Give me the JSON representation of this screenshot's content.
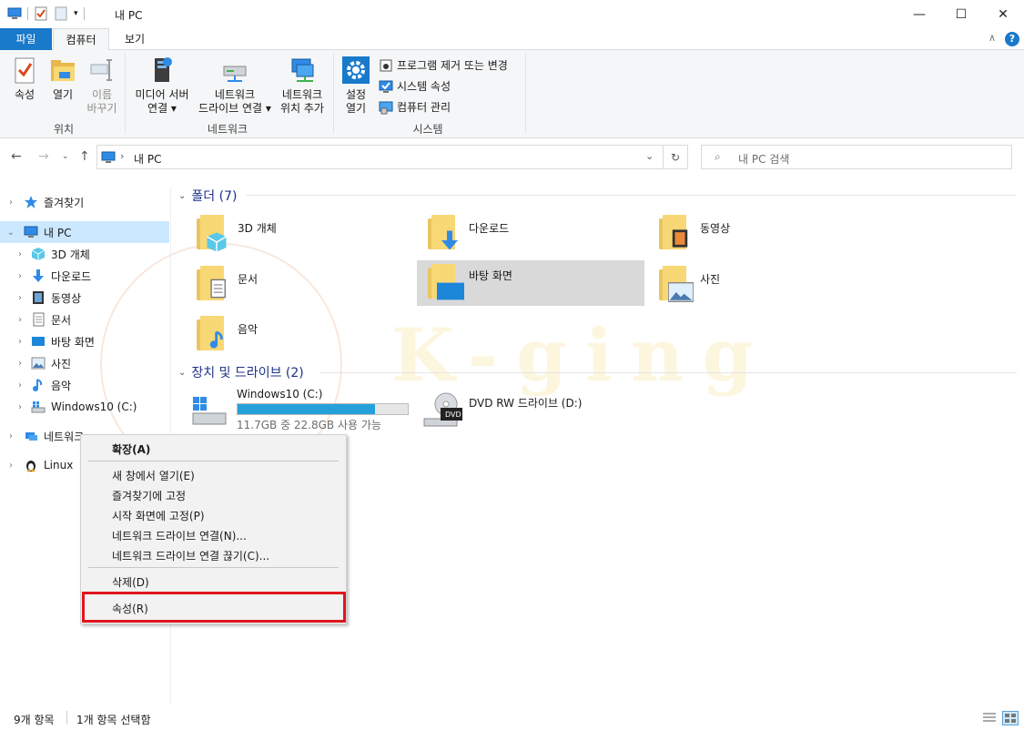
{
  "window": {
    "title": "내 PC",
    "minimize": "—",
    "maximize": "☐",
    "close": "✕"
  },
  "ribbon_tabs": [
    "파일",
    "컴퓨터",
    "보기"
  ],
  "ribbon": {
    "location": {
      "properties": "속성",
      "open": "열기",
      "rename_1": "이름",
      "rename_2": "바꾸기",
      "group": "위치"
    },
    "network": {
      "media_1": "미디어 서버",
      "media_2": "연결 ▾",
      "map_1": "네트워크",
      "map_2": "드라이브 연결 ▾",
      "add_1": "네트워크",
      "add_2": "위치 추가",
      "group": "네트워크"
    },
    "system": {
      "settings_1": "설정",
      "settings_2": "열기",
      "uninstall": "프로그램 제거 또는 변경",
      "sys_props": "시스템 속성",
      "manage": "컴퓨터 관리",
      "group": "시스템"
    }
  },
  "address": {
    "path": "내 PC",
    "search_placeholder": "내 PC 검색"
  },
  "nav": [
    {
      "label": "즐겨찾기",
      "icon": "star-icon"
    },
    {
      "label": "내 PC",
      "icon": "pc-icon",
      "selected": true
    },
    {
      "label": "3D 개체",
      "icon": "cube-icon"
    },
    {
      "label": "다운로드",
      "icon": "download-icon"
    },
    {
      "label": "동영상",
      "icon": "video-icon"
    },
    {
      "label": "문서",
      "icon": "document-icon"
    },
    {
      "label": "바탕 화면",
      "icon": "desktop-icon"
    },
    {
      "label": "사진",
      "icon": "pictures-icon"
    },
    {
      "label": "음악",
      "icon": "music-icon"
    },
    {
      "label": "Windows10 (C:)",
      "icon": "drive-icon"
    },
    {
      "label": "네트워크",
      "icon": "network-icon"
    },
    {
      "label": "Linux",
      "icon": "linux-icon"
    }
  ],
  "folders_header": "폴더 (7)",
  "folders": [
    "3D 개체",
    "다운로드",
    "동영상",
    "문서",
    "바탕 화면",
    "사진",
    "음악"
  ],
  "devices_header": "장치 및 드라이브 (2)",
  "drives": {
    "c_name": "Windows10 (C:)",
    "c_space": "11.7GB 중 22.8GB 사용 가능",
    "c_used_fraction": 0.81,
    "d_name": "DVD RW 드라이브 (D:)",
    "dvd_label": "DVD"
  },
  "context_menu": {
    "expand": "확장(A)",
    "open_new": "새 창에서 열기(E)",
    "pin_quick": "즐겨찾기에 고정",
    "pin_start": "시작 화면에 고정(P)",
    "map_drive": "네트워크 드라이브 연결(N)...",
    "disconnect": "네트워크 드라이브 연결 끊기(C)...",
    "delete": "삭제(D)",
    "properties": "속성(R)"
  },
  "status": {
    "count": "9개 항목",
    "selected": "1개 항목 선택함"
  },
  "watermark": "K-ging",
  "colors": {
    "accent": "#1979ca",
    "selection": "#cce8ff",
    "highlight": "#e0161d"
  }
}
